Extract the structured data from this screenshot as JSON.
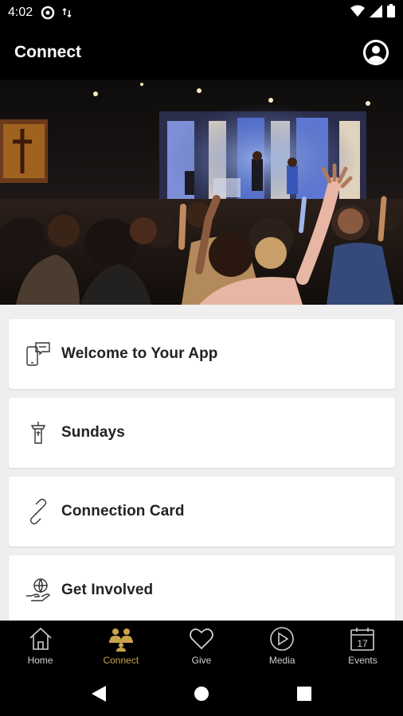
{
  "status_bar": {
    "time": "4:02",
    "icons": [
      "sync-icon",
      "data-icon",
      "wifi-icon",
      "signal-icon",
      "battery-icon"
    ]
  },
  "app_bar": {
    "title": "Connect",
    "profile_icon": "profile-icon"
  },
  "hero": {
    "description_icon": "worship-photo"
  },
  "cards": [
    {
      "label": "Welcome to Your App",
      "icon": "chat-phone-icon"
    },
    {
      "label": "Sundays",
      "icon": "pulpit-icon"
    },
    {
      "label": "Connection Card",
      "icon": "link-icon"
    },
    {
      "label": "Get Involved",
      "icon": "hand-globe-icon"
    }
  ],
  "bottom_nav": {
    "active": "Connect",
    "items": [
      {
        "label": "Home",
        "icon": "home-icon"
      },
      {
        "label": "Connect",
        "icon": "people-icon"
      },
      {
        "label": "Give",
        "icon": "heart-icon"
      },
      {
        "label": "Media",
        "icon": "play-icon"
      },
      {
        "label": "Events",
        "icon": "calendar-icon",
        "badge_text": "17"
      }
    ]
  },
  "colors": {
    "accent": "#c9a24a",
    "bar": "#000000",
    "content_bg": "#efefef",
    "card_bg": "#ffffff"
  }
}
